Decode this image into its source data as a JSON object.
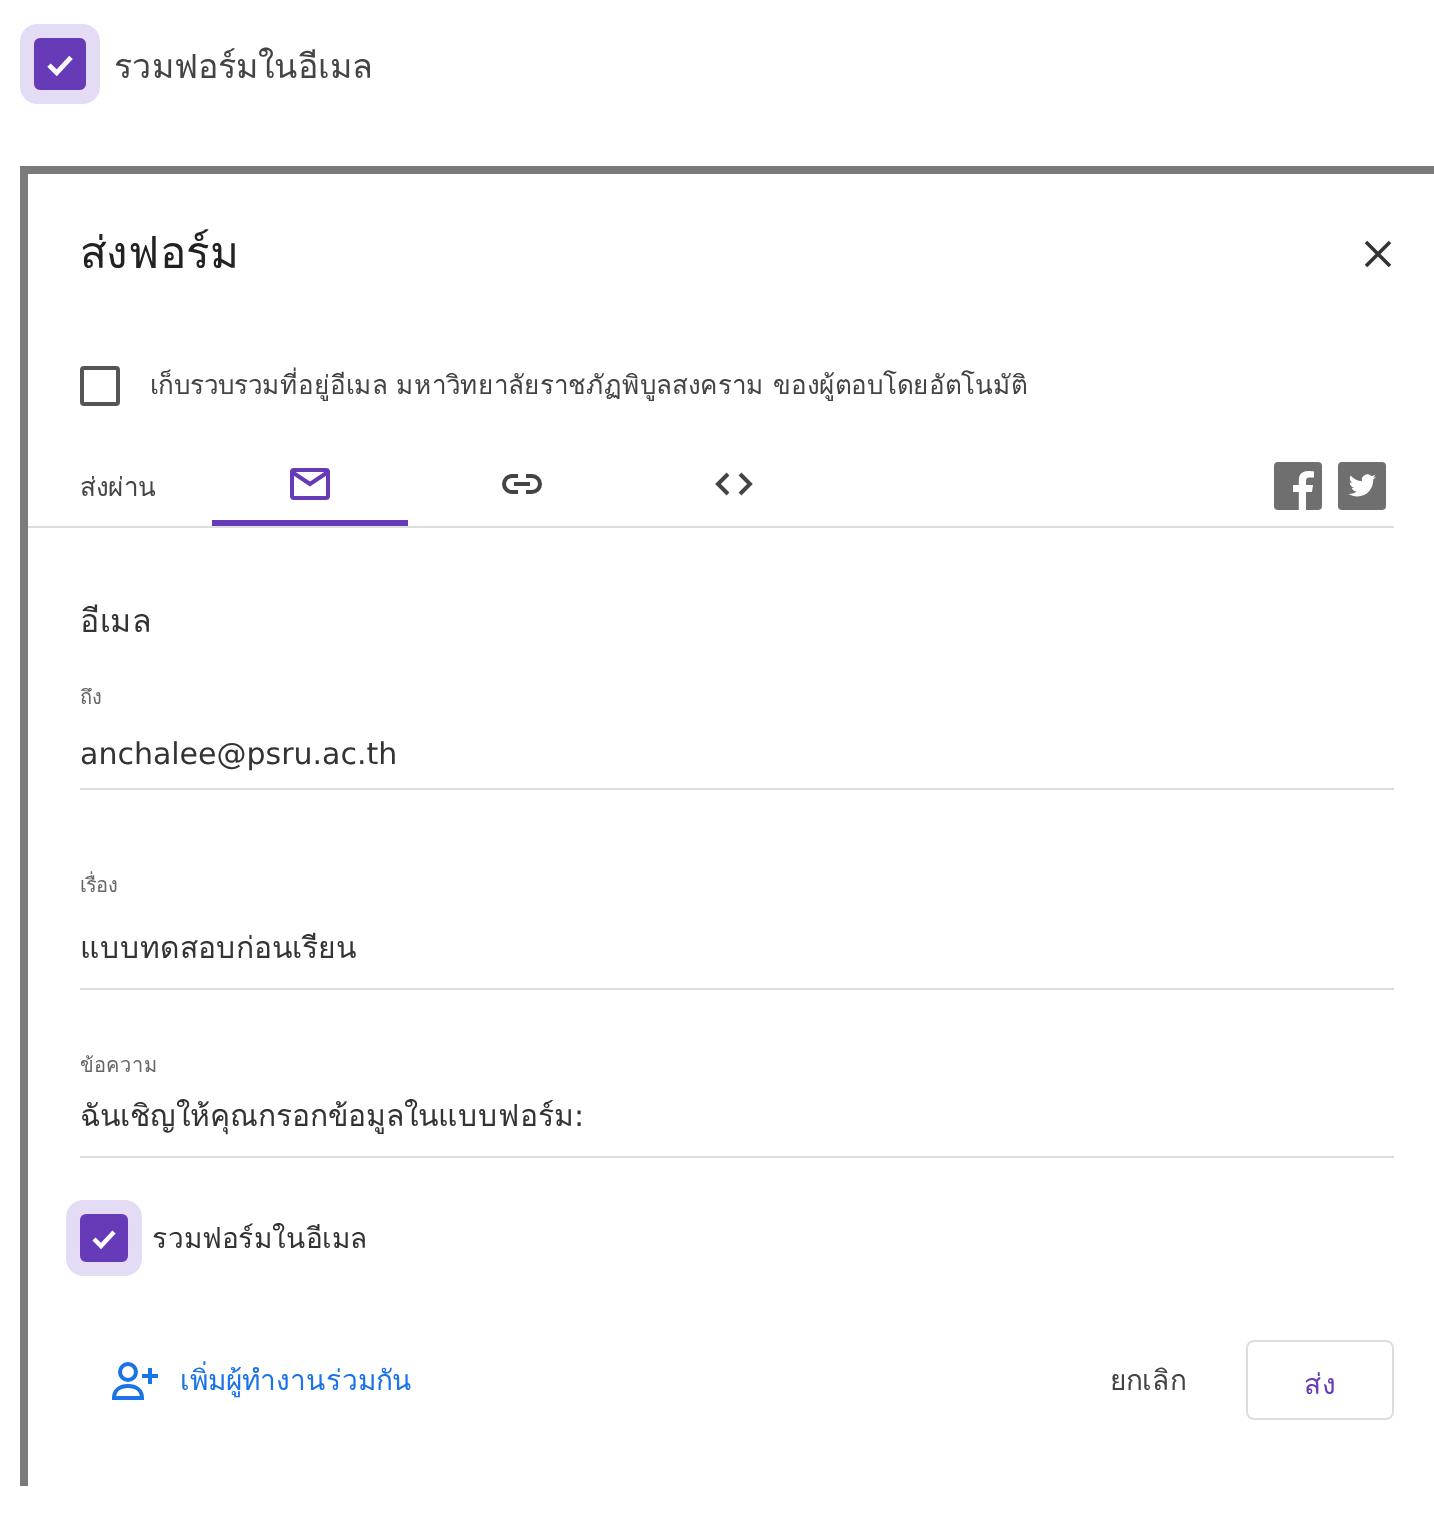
{
  "top_checkbox": {
    "label": "รวมฟอร์มในอีเมล",
    "checked": true
  },
  "dialog": {
    "title": "ส่งฟอร์ม",
    "collect_emails": {
      "label": "เก็บรวบรวมที่อยู่อีเมล มหาวิทยาลัยราชภัฏพิบูลสงคราม ของผู้ตอบโดยอัตโนมัติ",
      "checked": false
    },
    "send_via_label": "ส่งผ่าน",
    "tabs": [
      {
        "kind": "email",
        "selected": true
      },
      {
        "kind": "link",
        "selected": false
      },
      {
        "kind": "embed",
        "selected": false
      }
    ],
    "social": [
      {
        "kind": "facebook"
      },
      {
        "kind": "twitter"
      }
    ],
    "section_title": "อีเมล",
    "fields": [
      {
        "label": "ถึง",
        "value": "anchalee@psru.ac.th"
      },
      {
        "label": "เรื่อง",
        "value": "แบบทดสอบก่อนเรียน"
      },
      {
        "label": "ข้อความ",
        "value": "ฉันเชิญให้คุณกรอกข้อมูลในแบบฟอร์ม:"
      }
    ],
    "include_form": {
      "label": "รวมฟอร์มในอีเมล",
      "checked": true
    },
    "add_collaborators": "เพิ่มผู้ทำงานร่วมกัน",
    "buttons": [
      {
        "kind": "cancel",
        "label": "ยกเลิก"
      },
      {
        "kind": "send",
        "label": "ส่ง"
      }
    ]
  }
}
